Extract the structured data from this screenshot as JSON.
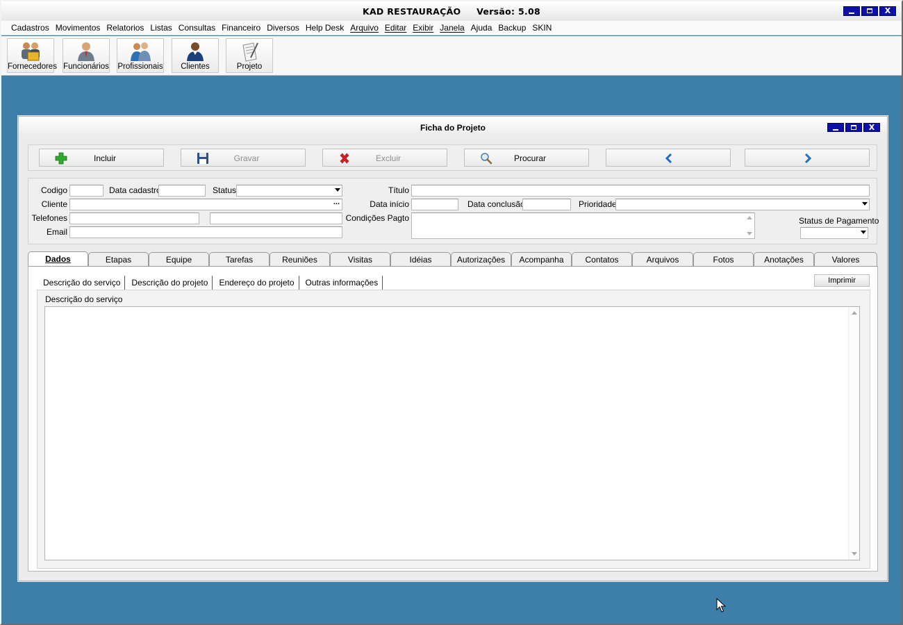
{
  "app": {
    "title": "KAD RESTAURAÇÃO",
    "version": "Versão: 5.08",
    "menu": [
      "Cadastros",
      "Movimentos",
      "Relatorios",
      "Listas",
      "Consultas",
      "Financeiro",
      "Diversos",
      "Help Desk",
      "Arquivo",
      "Editar",
      "Exibir",
      "Janela",
      "Ajuda",
      "Backup",
      "SKIN"
    ],
    "toolbar": [
      {
        "label": "Fornecedores",
        "icon": "suppliers-icon"
      },
      {
        "label": "Funcionários",
        "icon": "employee-icon"
      },
      {
        "label": "Profissionais",
        "icon": "professionals-icon"
      },
      {
        "label": "Clientes",
        "icon": "client-icon"
      },
      {
        "label": "Projeto",
        "icon": "project-icon"
      }
    ],
    "window_buttons": {
      "minimize": "_",
      "close": "X"
    }
  },
  "form": {
    "title": "Ficha do Projeto",
    "actions": {
      "include": "Incluir",
      "save": "Gravar",
      "delete": "Excluir",
      "search": "Procurar"
    },
    "fields": {
      "codigo_label": "Codigo",
      "codigo_value": "",
      "data_cadastro_label": "Data cadastro",
      "data_cadastro_value": "",
      "status_label": "Status",
      "status_value": "",
      "cliente_label": "Cliente",
      "cliente_value": "",
      "cliente_button": "...",
      "telefones_label": "Telefones",
      "telefone1_value": "",
      "telefone2_value": "",
      "email_label": "Email",
      "email_value": "",
      "titulo_label": "Título",
      "titulo_value": "",
      "data_inicio_label": "Data início",
      "data_inicio_value": "",
      "data_conclusao_label": "Data conclusão",
      "data_conclusao_value": "",
      "prioridade_label": "Prioridade",
      "prioridade_value": "",
      "condicoes_label": "Condições Pagto",
      "condicoes_value": "",
      "status_pagamento_label": "Status de Pagamento",
      "status_pagamento_value": ""
    },
    "tabs": [
      "Dados",
      "Etapas",
      "Equipe",
      "Tarefas",
      "Reuniões",
      "Visitas",
      "Idéias",
      "Autorizações",
      "Acompanha",
      "Contatos",
      "Arquivos",
      "Fotos",
      "Anotações",
      "Valores"
    ],
    "active_tab": "Dados",
    "subtabs": [
      "Descrição do serviço",
      "Descrição do projeto",
      "Endereço do projeto",
      "Outras informações"
    ],
    "active_subtab": "Descrição do serviço",
    "print_button": "Imprimir",
    "memo_label": "Descrição do serviço",
    "memo_value": ""
  },
  "colors": {
    "desktop": "#3e7faa",
    "window_button": "#0d10a8",
    "accent_green": "#2ea82e",
    "accent_red": "#d42020",
    "arrow_blue": "#1f6fc4"
  }
}
